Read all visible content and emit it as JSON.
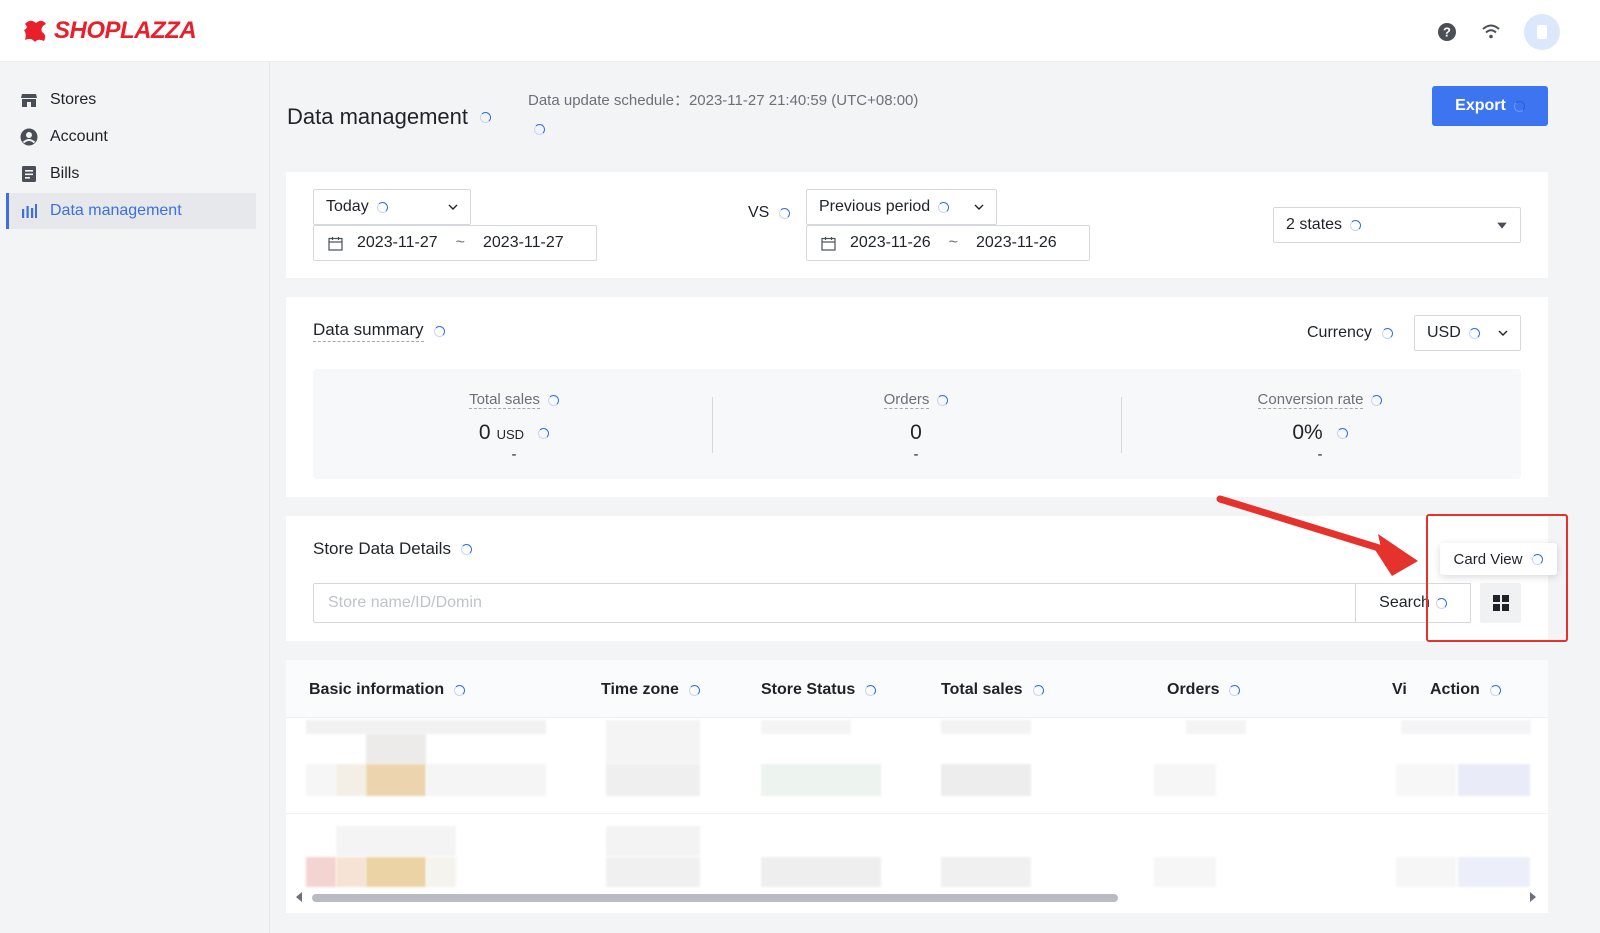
{
  "brand": {
    "name": "SHOPLAZZA",
    "color": "#e8202c"
  },
  "topbar": {
    "icons": [
      "help-icon",
      "wifi-icon",
      "avatar"
    ]
  },
  "sidebar": {
    "items": [
      {
        "label": "Stores",
        "icon": "store-icon"
      },
      {
        "label": "Account",
        "icon": "user-icon"
      },
      {
        "label": "Bills",
        "icon": "bill-icon"
      },
      {
        "label": "Data management",
        "icon": "chart-icon",
        "active": true
      }
    ]
  },
  "header": {
    "title": "Data management",
    "schedule": "Data update schedule：2023-11-27 21:40:59 (UTC+08:00)",
    "export_label": "Export"
  },
  "filters": {
    "period": "Today",
    "date_start": "2023-11-27",
    "date_end": "2023-11-27",
    "tilde": "~",
    "vs_label": "VS",
    "compare": "Previous period",
    "compare_start": "2023-11-26",
    "compare_end": "2023-11-26",
    "states": "2 states"
  },
  "summary": {
    "title": "Data summary",
    "currency_label": "Currency",
    "currency": "USD",
    "metrics": [
      {
        "label": "Total sales",
        "value": "0",
        "unit": "USD",
        "change": "-"
      },
      {
        "label": "Orders",
        "value": "0",
        "unit": "",
        "change": "-"
      },
      {
        "label": "Conversion rate",
        "value": "0%",
        "unit": "",
        "change": "-"
      }
    ]
  },
  "details": {
    "title": "Store Data Details",
    "search_placeholder": "Store name/ID/Domin",
    "search_label": "Search",
    "tooltip": "Card View"
  },
  "table": {
    "columns": [
      "Basic information",
      "Time zone",
      "Store Status",
      "Total sales",
      "Orders",
      "Vi",
      "Action"
    ]
  },
  "colors": {
    "accent": "#3d74f0",
    "annotation": "#e5322d"
  }
}
